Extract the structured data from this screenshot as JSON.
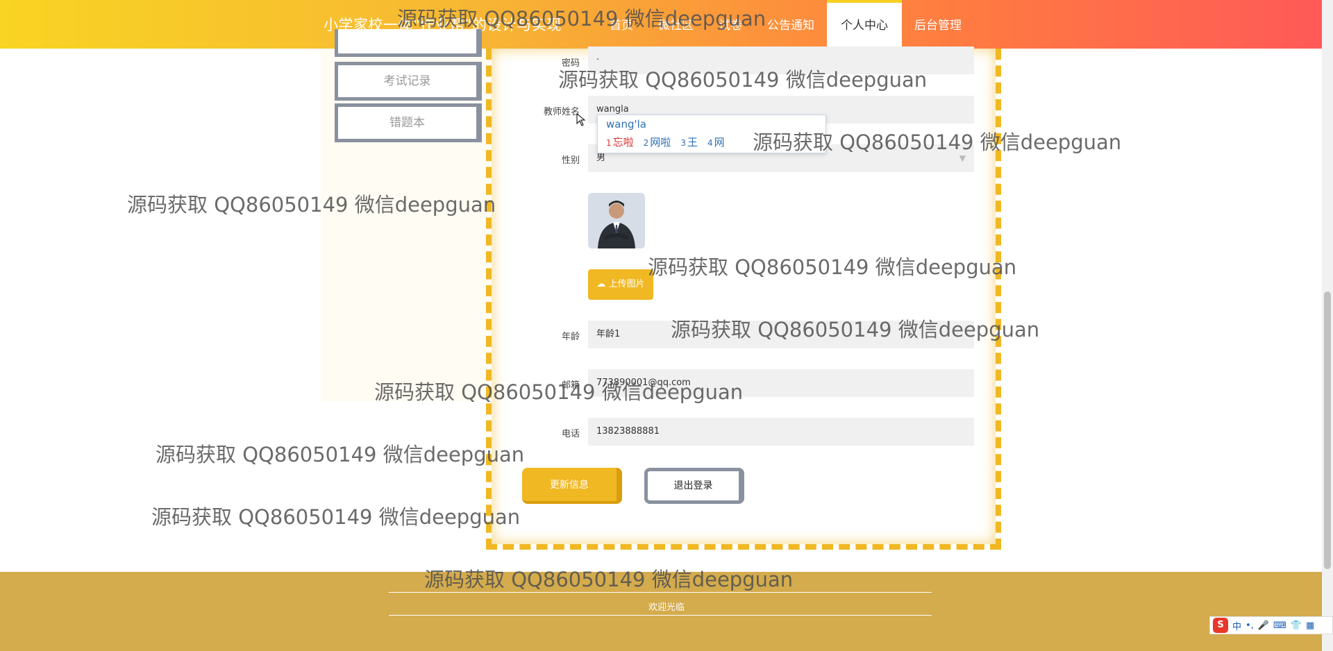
{
  "header": {
    "site_title": "小学家校一体\"作业帮\"的设计与实现",
    "nav": [
      "首页",
      "微社区",
      "试卷",
      "公告通知",
      "个人中心",
      "后台管理"
    ],
    "active_nav": "个人中心"
  },
  "sidebar": {
    "items": [
      "考试记录",
      "错题本"
    ]
  },
  "form": {
    "password": {
      "label": "密码",
      "value": "·"
    },
    "teacher_name": {
      "label": "教师姓名",
      "value": "wangla"
    },
    "gender": {
      "label": "性别",
      "value": "男"
    },
    "upload_label": "上传图片",
    "age": {
      "label": "年龄",
      "value": "年龄1"
    },
    "email": {
      "label": "邮箱",
      "value": "773890001@qq.com"
    },
    "phone": {
      "label": "电话",
      "value": "13823888881"
    },
    "update_button": "更新信息",
    "logout_button": "退出登录"
  },
  "ime_popup": {
    "input": "wang'la",
    "candidates": [
      {
        "num": "1",
        "text": "忘啦"
      },
      {
        "num": "2",
        "text": "网啦"
      },
      {
        "num": "3",
        "text": "王"
      },
      {
        "num": "4",
        "text": "网"
      }
    ]
  },
  "footer": {
    "text": "欢迎光临"
  },
  "watermark": "源码获取 QQ86050149 微信deepguan",
  "ime_toolbar": {
    "logo": "S",
    "mode": "中",
    "punct": "•,"
  }
}
